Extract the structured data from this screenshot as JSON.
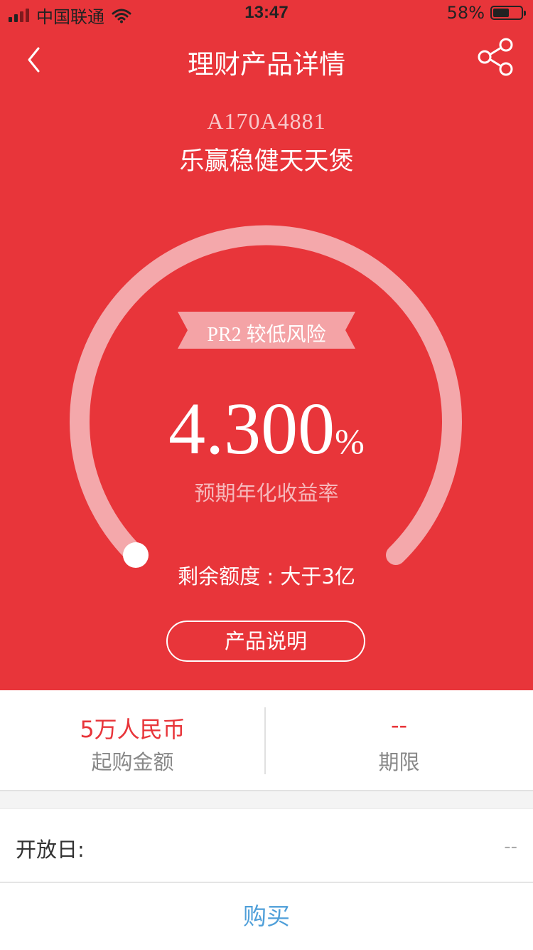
{
  "status_bar": {
    "carrier": "中国联通",
    "time": "13:47",
    "battery": "58%",
    "battery_level": 0.58
  },
  "nav": {
    "title": "理财产品详情"
  },
  "product": {
    "code": "A170A4881",
    "name": "乐赢稳健天天煲",
    "risk": "PR2 较低风险",
    "rate_value": "4.300",
    "rate_unit": "%",
    "rate_label": "预期年化收益率",
    "quota": "剩余额度 : 大于3亿",
    "desc_button": "产品说明"
  },
  "info": {
    "min_amount_value": "5万人民币",
    "min_amount_label": "起购金额",
    "term_value": "--",
    "term_label": "期限"
  },
  "open_day": {
    "label": "开放日:",
    "value": "--"
  },
  "buy_button": "购买",
  "colors": {
    "brand_red": "#e8353a",
    "link_blue": "#4f9fd9"
  },
  "icons": {
    "back": "chevron-left-icon",
    "share": "share-icon",
    "wifi": "wifi-icon",
    "battery": "battery-icon"
  }
}
